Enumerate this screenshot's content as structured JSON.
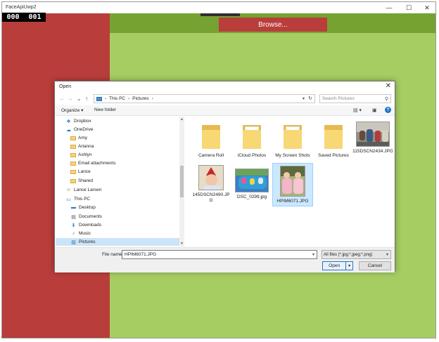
{
  "app": {
    "title": "FaceApiUwp2",
    "minimize_glyph": "—",
    "maximize_glyph": "☐",
    "close_glyph": "✕",
    "counter_left": "000",
    "counter_right": "001",
    "browse_label": "Browse...",
    "colors": {
      "red": "#b93d3a",
      "green": "#a5cd62",
      "green_dark": "#76a232"
    }
  },
  "dialog": {
    "title": "Open",
    "close_glyph": "✕",
    "nav": {
      "back": "←",
      "forward": "→",
      "recent": "⌄",
      "up": "↑"
    },
    "breadcrumb": [
      "This PC",
      "Pictures"
    ],
    "breadcrumb_sep": "›",
    "search_placeholder": "Search Pictures",
    "toolbar": {
      "organize": "Organize ▾",
      "new_folder": "New folder"
    },
    "nav_items": [
      {
        "label": "Dropbox",
        "icon": "dropbox-icon"
      },
      {
        "label": "OneDrive",
        "icon": "cloud-icon"
      },
      {
        "label": "Amy",
        "icon": "folder-icon"
      },
      {
        "label": "Arianna",
        "icon": "folder-icon"
      },
      {
        "label": "Ashlyn",
        "icon": "folder-icon"
      },
      {
        "label": "Email attachments",
        "icon": "folder-icon"
      },
      {
        "label": "Lance",
        "icon": "folder-icon"
      },
      {
        "label": "Shared",
        "icon": "folder-icon"
      },
      {
        "label": "Lance Larsen",
        "icon": "user-icon"
      },
      {
        "label": "This PC",
        "icon": "computer-icon"
      },
      {
        "label": "Desktop",
        "icon": "desktop-icon"
      },
      {
        "label": "Documents",
        "icon": "documents-icon"
      },
      {
        "label": "Downloads",
        "icon": "download-icon"
      },
      {
        "label": "Music",
        "icon": "music-icon"
      },
      {
        "label": "Pictures",
        "icon": "pictures-icon",
        "selected": true
      }
    ],
    "files": [
      {
        "label": "Camera Roll",
        "kind": "folder"
      },
      {
        "label": "iCloud Photos",
        "kind": "folder"
      },
      {
        "label": "My Screen Shots",
        "kind": "folder"
      },
      {
        "label": "Saved Pictures",
        "kind": "folder"
      },
      {
        "label": "115DSCN2434.JPG",
        "kind": "image"
      },
      {
        "label": "145DSCN2490.JPG",
        "kind": "image"
      },
      {
        "label": "DSC_0299.jpg",
        "kind": "image"
      },
      {
        "label": "HPIM6071.JPG",
        "kind": "image",
        "selected": true
      }
    ],
    "file_name_label": "File name:",
    "file_name_value": "HPIM6071.JPG",
    "file_type_value": "All files (*.jpg;*.jpeg;*.png)",
    "open_label": "Open",
    "cancel_label": "Cancel"
  }
}
